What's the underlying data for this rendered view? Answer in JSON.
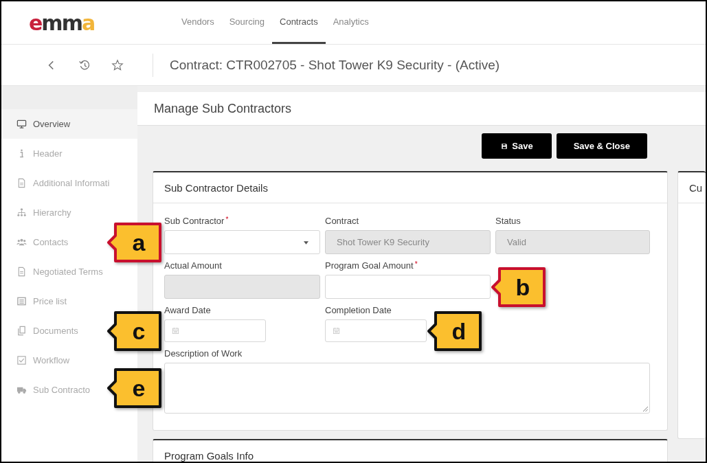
{
  "logo": "emma",
  "nav": [
    {
      "label": "Vendors",
      "selected": false
    },
    {
      "label": "Sourcing",
      "selected": false
    },
    {
      "label": "Contracts",
      "selected": true
    },
    {
      "label": "Analytics",
      "selected": false
    }
  ],
  "page_title": "Contract: CTR002705 - Shot Tower K9 Security - (Active)",
  "sidebar": {
    "items": [
      {
        "label": "Overview",
        "selected": true
      },
      {
        "label": "Header",
        "selected": false
      },
      {
        "label": "Additional Informati",
        "selected": false
      },
      {
        "label": "Hierarchy",
        "selected": false
      },
      {
        "label": "Contacts",
        "selected": false
      },
      {
        "label": "Negotiated Terms",
        "selected": false
      },
      {
        "label": "Price list",
        "selected": false
      },
      {
        "label": "Documents",
        "selected": false
      },
      {
        "label": "Workflow",
        "selected": false
      },
      {
        "label": "Sub Contracto",
        "selected": false
      }
    ]
  },
  "panel_title": "Manage Sub Contractors",
  "buttons": [
    {
      "label": "Save",
      "kind": "save"
    },
    {
      "label": "Save & Close",
      "kind": "plain"
    }
  ],
  "details": {
    "title": "Sub Contractor Details",
    "fields": [
      {
        "label": "Sub Contractor",
        "required_mark": "*",
        "kind": "dropdown",
        "disabled": false,
        "callout": {
          "letter": "a",
          "color": "#c8102e",
          "kind": "outer"
        }
      },
      {
        "label": "Contract",
        "kind": "text",
        "disabled": true,
        "value": "Shot Tower K9 Security"
      },
      {
        "label": "Status",
        "kind": "text",
        "disabled": true,
        "value": "Valid"
      },
      {
        "label": "Actual Amount",
        "kind": "text",
        "disabled": true
      },
      {
        "label": "Program Goal Amount",
        "required_mark": "*",
        "kind": "text",
        "disabled": false,
        "callout": {
          "letter": "b",
          "color": "#c8102e",
          "kind": "inner"
        }
      },
      {
        "label": "Award Date",
        "kind": "date",
        "disabled": false,
        "callout": {
          "letter": "c",
          "color": "#111111",
          "kind": "outer"
        }
      },
      {
        "label": "Completion Date",
        "kind": "date",
        "disabled": false,
        "callout": {
          "letter": "d",
          "color": "#111111",
          "kind": "inner"
        }
      },
      {
        "label": "Description of Work",
        "kind": "textarea",
        "disabled": false,
        "callout": {
          "letter": "e",
          "color": "#111111",
          "kind": "outer"
        }
      }
    ]
  },
  "side_card": {
    "title": "Cu"
  },
  "goals_card": {
    "title": "Program Goals Info"
  }
}
